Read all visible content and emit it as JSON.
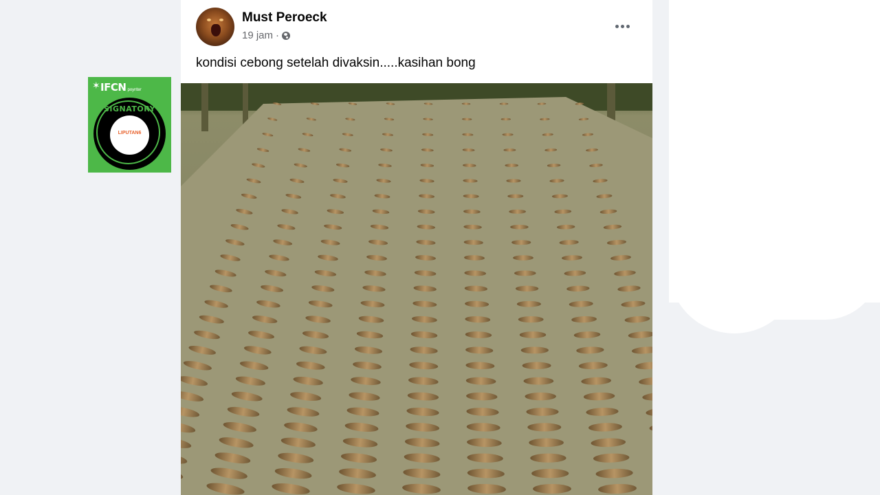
{
  "badge": {
    "brand": "IFCN",
    "brand_small": "poynter",
    "ring_text": "SIGNATORY",
    "inner_text": "LIPUTAN6"
  },
  "post": {
    "author": "Must Peroeck",
    "time": "19 jam",
    "separator": "·",
    "privacy_icon": "globe-icon",
    "more_icon": "more-horizontal-icon",
    "text": "kondisi cebong setelah divaksin.....kasihan bong"
  },
  "colors": {
    "background": "#f0f2f5",
    "card": "#ffffff",
    "badge_green": "#4db848",
    "secondary_text": "#65676b"
  }
}
